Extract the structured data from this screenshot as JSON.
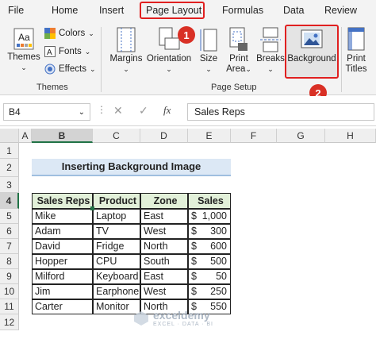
{
  "tabs": [
    "File",
    "Home",
    "Insert",
    "Page Layout",
    "Formulas",
    "Data",
    "Review"
  ],
  "badges": {
    "one": "1",
    "two": "2"
  },
  "themes_group": {
    "themes_label": "Themes",
    "colors_label": "Colors",
    "fonts_label": "Fonts",
    "effects_label": "Effects",
    "group_label": "Themes"
  },
  "page_setup": {
    "margins": "Margins",
    "orientation": "Orientation",
    "size": "Size",
    "print_area_1": "Print",
    "print_area_2": "Area",
    "breaks": "Breaks",
    "background": "Background",
    "print_titles_1": "Print",
    "print_titles_2": "Titles",
    "group_label": "Page Setup"
  },
  "formula_bar": {
    "name_box": "B4",
    "fx": "fx",
    "content": "Sales Reps"
  },
  "columns": [
    "A",
    "B",
    "C",
    "D",
    "E",
    "F",
    "G",
    "H"
  ],
  "rows": [
    "1",
    "2",
    "3",
    "4",
    "5",
    "6",
    "7",
    "8",
    "9",
    "10",
    "11",
    "12"
  ],
  "sheet": {
    "title": "Inserting Background Image",
    "headers": [
      "Sales Reps",
      "Product",
      "Zone",
      "Sales"
    ],
    "data": [
      [
        "Mike",
        "Laptop",
        "East",
        "$",
        "1,000"
      ],
      [
        "Adam",
        "TV",
        "West",
        "$",
        "300"
      ],
      [
        "David",
        "Fridge",
        "North",
        "$",
        "600"
      ],
      [
        "Hopper",
        "CPU",
        "South",
        "$",
        "500"
      ],
      [
        "Milford",
        "Keyboard",
        "East",
        "$",
        "50"
      ],
      [
        "Jim",
        "Earphone",
        "West",
        "$",
        "250"
      ],
      [
        "Carter",
        "Monitor",
        "North",
        "$",
        "550"
      ]
    ]
  },
  "watermark": {
    "brand": "exceldemy",
    "tagline": "EXCEL · DATA · BI"
  },
  "colors": {
    "accent_red": "#e02020",
    "title_fill": "#dce8f5",
    "header_fill": "#e2f0d9"
  }
}
